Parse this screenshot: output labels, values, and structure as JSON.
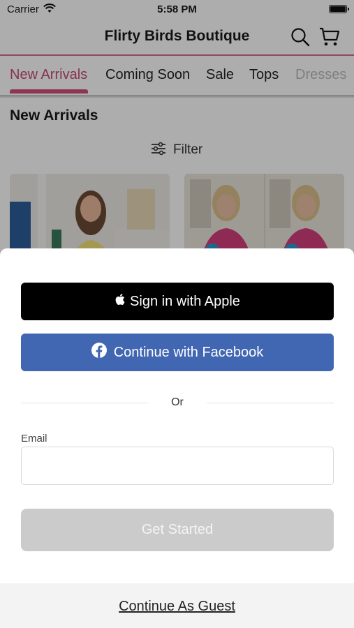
{
  "status": {
    "carrier": "Carrier",
    "time": "5:58 PM"
  },
  "header": {
    "title": "Flirty Birds Boutique"
  },
  "tabs": [
    {
      "label": "New Arrivals"
    },
    {
      "label": "Coming Soon"
    },
    {
      "label": "Sale"
    },
    {
      "label": "Tops"
    },
    {
      "label": "Dresses"
    }
  ],
  "section": {
    "title": "New Arrivals",
    "filter_label": "Filter"
  },
  "sheet": {
    "apple_label": "Sign in with Apple",
    "facebook_label": "Continue with Facebook",
    "or_text": "Or",
    "email_label": "Email",
    "email_value": "",
    "get_started_label": "Get Started",
    "guest_label": "Continue As Guest"
  },
  "colors": {
    "accent": "#c94a74",
    "facebook": "#4267b2",
    "apple": "#000000",
    "disabled_button": "#cbcbcb"
  },
  "icons": [
    "wifi-icon",
    "battery-icon",
    "search-icon",
    "cart-icon",
    "filter-icon",
    "apple-icon",
    "facebook-icon"
  ]
}
